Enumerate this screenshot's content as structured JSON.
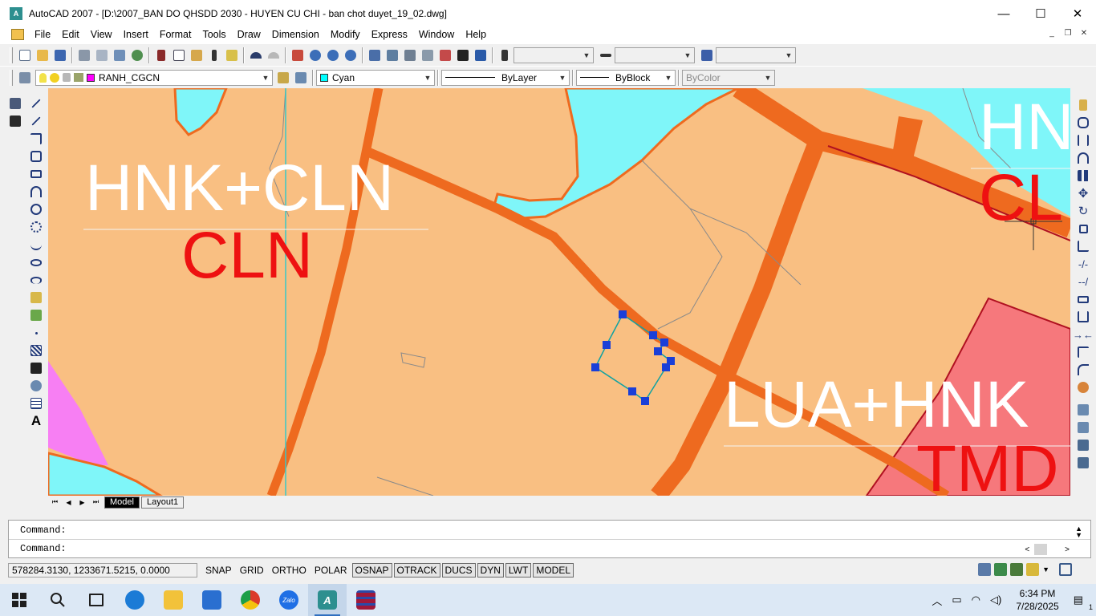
{
  "window": {
    "title": "AutoCAD 2007 - [D:\\2007_BAN DO QHSDD 2030 - HUYEN CU CHI - ban chot duyet_19_02.dwg]",
    "logo": "A",
    "minimize": "—",
    "maximize": "☐",
    "close": "✕"
  },
  "menu": [
    "File",
    "Edit",
    "View",
    "Insert",
    "Format",
    "Tools",
    "Draw",
    "Dimension",
    "Modify",
    "Express",
    "Window",
    "Help"
  ],
  "mdi": {
    "minimize": "_",
    "restore": "❐",
    "close": "✕"
  },
  "layers": {
    "current_layer": "RANH_CGCN",
    "layer_color": "#ff00ff"
  },
  "properties": {
    "color": "Cyan",
    "color_swatch": "#00ffff",
    "linetype": "ByLayer",
    "lineweight": "ByBlock",
    "plotstyle": "ByColor"
  },
  "map_labels": {
    "label1_top": "HNK+CLN",
    "label1_bottom": "CLN",
    "label2_top": "HN",
    "label2_bottom": "CL",
    "label3_top": "LUA+HNK",
    "label3_bottom": "TMD"
  },
  "tabs": {
    "model": "Model",
    "layout1": "Layout1"
  },
  "nav": {
    "first": "⏮",
    "prev": "◀",
    "next": "▶",
    "last": "⏭"
  },
  "command": {
    "line1": "Command:",
    "line2": "Command:",
    "up": "▲",
    "down": "▼",
    "left": "<",
    "right": ">"
  },
  "status": {
    "coords": "578284.3130, 1233671.5215, 0.0000",
    "buttons": [
      {
        "label": "SNAP",
        "on": false
      },
      {
        "label": "GRID",
        "on": false
      },
      {
        "label": "ORTHO",
        "on": false
      },
      {
        "label": "POLAR",
        "on": false
      },
      {
        "label": "OSNAP",
        "on": true
      },
      {
        "label": "OTRACK",
        "on": true
      },
      {
        "label": "DUCS",
        "on": true
      },
      {
        "label": "DYN",
        "on": true
      },
      {
        "label": "LWT",
        "on": true
      },
      {
        "label": "MODEL",
        "on": true
      }
    ]
  },
  "taskbar": {
    "time": "6:34 PM",
    "date": "7/28/2025",
    "zalo": "Zalo",
    "acad": "A",
    "notifications": "1"
  }
}
